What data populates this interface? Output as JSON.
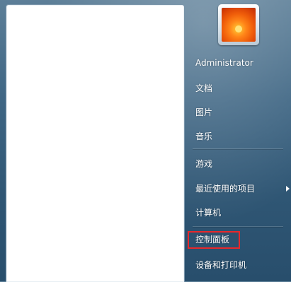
{
  "user": {
    "name": "Administrator",
    "avatar_icon": "user-picture-flower-icon"
  },
  "menu": {
    "items": [
      {
        "label": "文档"
      },
      {
        "label": "图片"
      },
      {
        "label": "音乐"
      },
      {
        "label": "游戏"
      },
      {
        "label": "最近使用的项目",
        "has_submenu": true
      },
      {
        "label": "计算机"
      },
      {
        "label": "控制面板",
        "highlighted": true
      },
      {
        "label": "设备和打印机"
      }
    ]
  },
  "colors": {
    "highlight_border": "#e8282b"
  }
}
